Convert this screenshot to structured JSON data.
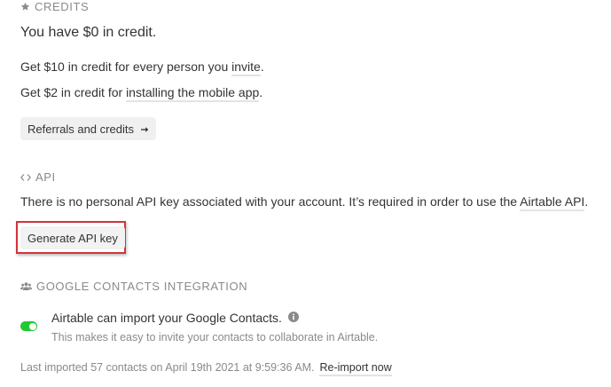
{
  "credits": {
    "header": "CREDITS",
    "header_icon": "star-icon",
    "balance_text": "You have $0 in credit.",
    "invite_line_prefix": "Get $10 in credit for every person you ",
    "invite_link": "invite",
    "invite_line_suffix": ".",
    "mobile_line_prefix": "Get $2 in credit for ",
    "mobile_link": "installing the mobile app",
    "mobile_line_suffix": ".",
    "referrals_button": "Referrals and credits",
    "referrals_button_icon": "arrow-right-icon"
  },
  "api": {
    "header": "API",
    "header_icon": "code-icon",
    "description_prefix": "There is no personal API key associated with your account. It’s required in order to use the ",
    "description_link": "Airtable API",
    "description_suffix": ".",
    "generate_button": "Generate API key",
    "highlight_color": "#d4323a"
  },
  "google_contacts": {
    "header": "GOOGLE CONTACTS INTEGRATION",
    "header_icon": "users-icon",
    "toggle_enabled": true,
    "toggle_color": "#20c933",
    "title": "Airtable can import your Google Contacts.",
    "info_icon": "info-icon",
    "description": "This makes it easy to invite your contacts to collaborate in Airtable.",
    "last_imported": "Last imported 57 contacts on April 19th 2021 at 9:59:36 AM.",
    "reimport_link": "Re-import now"
  }
}
